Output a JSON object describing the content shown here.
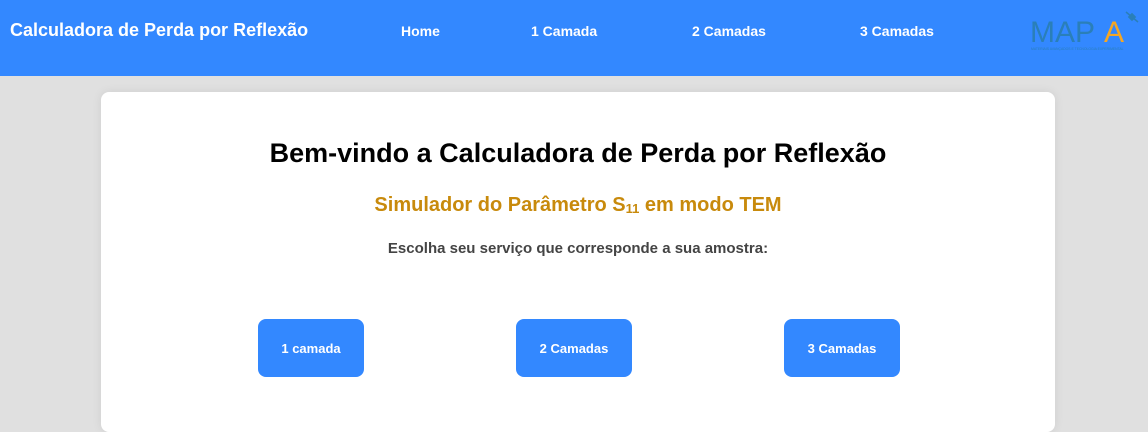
{
  "header": {
    "brand": "Calculadora de Perda por Reflexão",
    "nav": [
      {
        "label": "Home"
      },
      {
        "label": "1 Camada"
      },
      {
        "label": "2 Camadas"
      },
      {
        "label": "3 Camadas"
      }
    ],
    "logo": {
      "text_main": "MAP",
      "text_accent": "A",
      "tagline": "MATERIAIS AVANÇADOS E TECNOLOGIA EXPERIMENTAL",
      "colors": {
        "main": "#2a7fb8",
        "accent": "#f5a623"
      }
    }
  },
  "main": {
    "title": "Bem-vindo a Calculadora de Perda por Reflexão",
    "subtitle_before": "Simulador do Parâmetro S",
    "subtitle_subscript": "11",
    "subtitle_after": " em modo TEM",
    "prompt": "Escolha seu serviço que corresponde a sua amostra:",
    "buttons": [
      {
        "label": "1 camada"
      },
      {
        "label": "2 Camadas"
      },
      {
        "label": "3 Camadas"
      }
    ]
  },
  "colors": {
    "primary": "#3388ff",
    "background": "#e0e0e0",
    "subtitle": "#c88a0c"
  }
}
